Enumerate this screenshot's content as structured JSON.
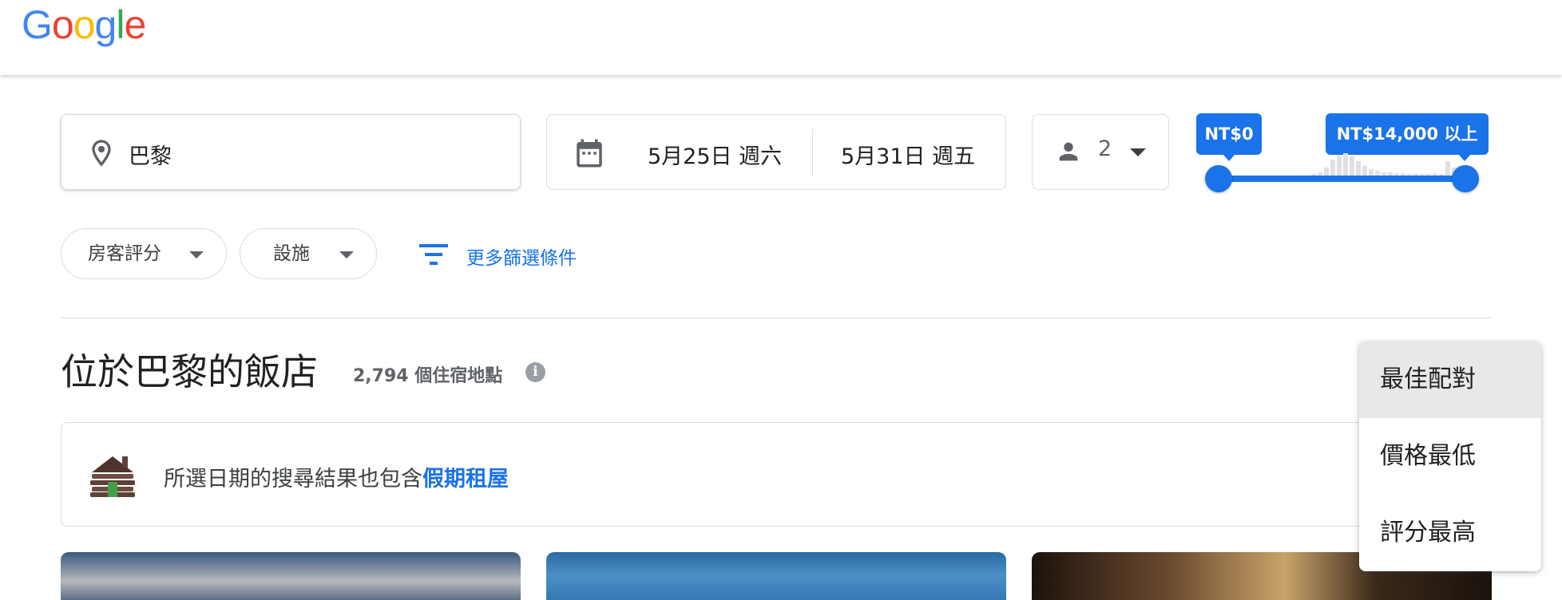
{
  "header": {
    "logo_letters": [
      "G",
      "o",
      "o",
      "g",
      "l",
      "e"
    ],
    "logo_colors": [
      "#4285F4",
      "#EA4335",
      "#FBBC05",
      "#4285F4",
      "#34A853",
      "#EA4335"
    ]
  },
  "search": {
    "location": "巴黎",
    "check_in": "5月25日 週六",
    "check_out": "5月31日 週五",
    "guests": "2"
  },
  "price_filter": {
    "min_label": "NT$0",
    "max_label": "NT$14,000 以上",
    "accent_color": "#1a73e8"
  },
  "filters": {
    "rating_label": "房客評分",
    "amenities_label": "設施",
    "more_label": "更多篩選條件"
  },
  "results": {
    "title": "位於巴黎的飯店",
    "count": "2,794 個住宿地點",
    "info_icon": "i"
  },
  "banner": {
    "text": "所選日期的搜尋結果也包含",
    "link": "假期租屋"
  },
  "sort_menu": {
    "items": [
      "最佳配對",
      "價格最低",
      "評分最高"
    ],
    "selected": "最佳配對"
  }
}
